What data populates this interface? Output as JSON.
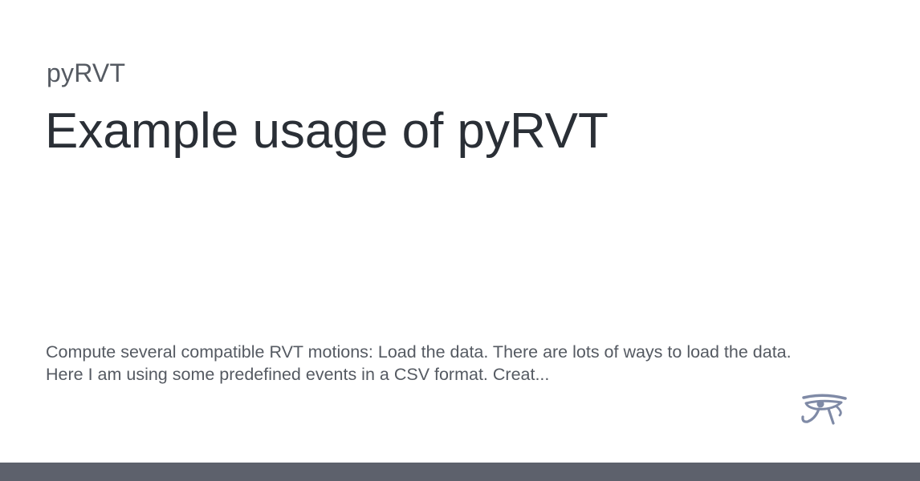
{
  "site": {
    "name": "pyRVT"
  },
  "page": {
    "title": "Example usage of pyRVT",
    "description": "Compute several compatible RVT motions: Load the data. There are lots of ways to load the data. Here I am using some predefined events in a CSV format. Creat..."
  },
  "logo": {
    "icon": "eye-of-horus-icon",
    "color": "#7f8aa6"
  },
  "colors": {
    "footer_bar": "#5d616c",
    "background": "#ffffff"
  }
}
